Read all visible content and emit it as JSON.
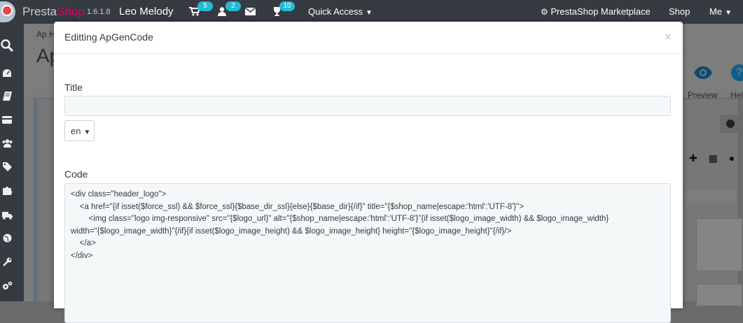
{
  "topbar": {
    "brand_a": "Presta",
    "brand_b": "Shop",
    "version": "1.6.1.8",
    "shop_name": "Leo Melody",
    "orders_badge": "5",
    "customers_badge": "2",
    "trophy_badge": "10",
    "quick_access": "Quick Access",
    "marketplace": "PrestaShop Marketplace",
    "shop": "Shop",
    "me": "Me"
  },
  "background": {
    "breadcrumb": "Ap H",
    "title": "Ap",
    "preview": "Preview",
    "help": "Hel"
  },
  "modal": {
    "title": "Editting ApGenCode",
    "close": "×",
    "title_label": "Title",
    "title_value": "",
    "language": "en",
    "code_label": "Code",
    "code_value": "<div class=\"header_logo\">\n    <a href=\"{if isset($force_ssl) && $force_ssl}{$base_dir_ssl}{else}{$base_dir}{/if}\" title=\"{$shop_name|escape:'html':'UTF-8'}\">\n        <img class=\"logo img-responsive\" src=\"{$logo_url}\" alt=\"{$shop_name|escape:'html':'UTF-8'}\"{if isset($logo_image_width) && $logo_image_width}\nwidth=\"{$logo_image_width}\"{/if}{if isset($logo_image_height) && $logo_image_height} height=\"{$logo_image_height}\"{/if}/>\n    </a>\n</div>"
  },
  "icons": {
    "search": "search-icon",
    "dashboard": "dashboard-icon",
    "catalog": "book-icon",
    "orders": "credit-card-icon",
    "customers": "users-icon",
    "price_rules": "tag-icon",
    "modules": "puzzle-icon",
    "shipping": "truck-icon",
    "localization": "globe-icon",
    "preferences": "wrench-icon",
    "advanced": "cogs-icon"
  }
}
